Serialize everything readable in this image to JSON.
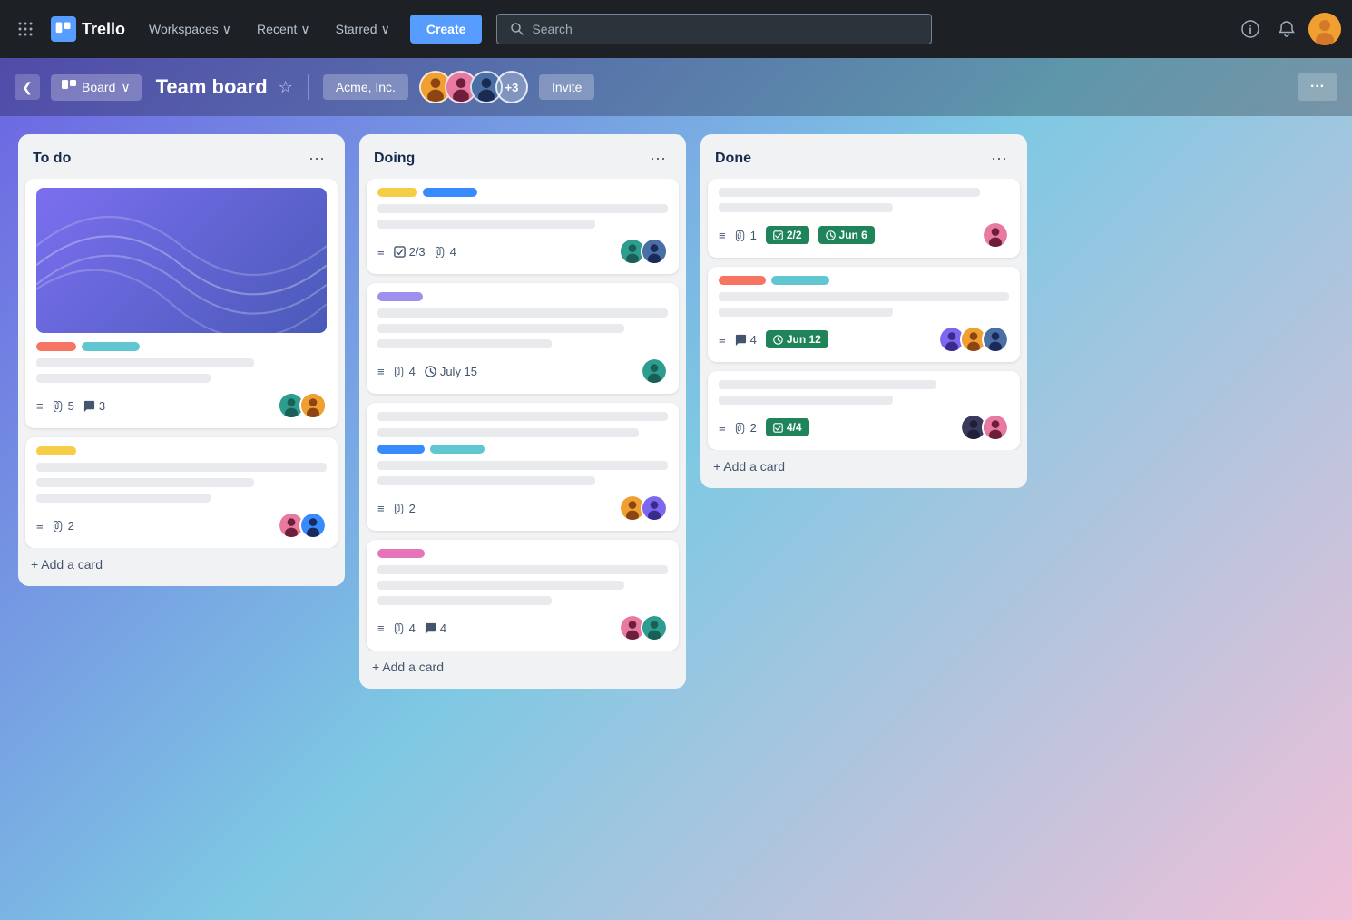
{
  "app": {
    "name": "Trello",
    "logo_icon": "T"
  },
  "navbar": {
    "grid_icon": "⋮⋮⋮",
    "workspaces_label": "Workspaces",
    "recent_label": "Recent",
    "starred_label": "Starred",
    "create_label": "Create",
    "search_placeholder": "Search",
    "info_icon": "ⓘ",
    "bell_icon": "🔔"
  },
  "board_header": {
    "sidebar_toggle": "❮",
    "view_icon": "▦",
    "view_label": "Board",
    "board_title": "Team board",
    "star_icon": "☆",
    "workspace_label": "Acme, Inc.",
    "member_count": "+3",
    "invite_label": "Invite",
    "more_label": "···"
  },
  "columns": [
    {
      "title": "To do",
      "cards": [
        {
          "type": "image_card",
          "labels": [
            "pink",
            "cyan"
          ],
          "has_image": true,
          "meta": {
            "list": true,
            "attachments": "5",
            "comments": "3"
          },
          "members": [
            "teal",
            "yellow-warm"
          ]
        },
        {
          "type": "text_card",
          "labels": [
            "yellow"
          ],
          "meta": {
            "list": true,
            "attachments": "2"
          },
          "members": [
            "pink",
            "blue"
          ]
        }
      ],
      "add_card_label": "+ Add a card"
    },
    {
      "title": "Doing",
      "cards": [
        {
          "type": "text_card",
          "labels": [
            "yellow",
            "blue"
          ],
          "meta": {
            "list": true,
            "checks": "2/3",
            "attachments": "4"
          },
          "members": [
            "teal",
            "blue"
          ]
        },
        {
          "type": "text_card",
          "labels": [
            "purple"
          ],
          "meta": {
            "list": true,
            "attachments": "4",
            "due": "July 15"
          },
          "members": [
            "teal"
          ]
        },
        {
          "type": "text_card",
          "labels": [
            "blue",
            "teal"
          ],
          "meta": {
            "list": true,
            "attachments": "2"
          },
          "members": [
            "yellow-warm",
            "purple"
          ]
        },
        {
          "type": "text_card",
          "labels": [
            "magenta"
          ],
          "meta": {
            "list": true,
            "attachments": "4",
            "comments": "4"
          },
          "members": [
            "pink",
            "teal"
          ]
        }
      ],
      "add_card_label": "+ Add a card"
    },
    {
      "title": "Done",
      "cards": [
        {
          "type": "text_card",
          "labels": [],
          "meta": {
            "list": true,
            "attachments": "1",
            "checks": "2/2",
            "due": "Jun 6"
          },
          "members": [
            "pink"
          ]
        },
        {
          "type": "text_card",
          "labels": [
            "pink",
            "teal"
          ],
          "meta": {
            "list": true,
            "comments": "4",
            "due": "Jun 12"
          },
          "members": [
            "purple",
            "yellow-warm",
            "blue"
          ]
        },
        {
          "type": "text_card",
          "labels": [],
          "meta": {
            "list": true,
            "attachments": "2",
            "checks": "4/4"
          },
          "members": [
            "dark",
            "pink"
          ]
        }
      ],
      "add_card_label": "+ Add a card"
    }
  ]
}
